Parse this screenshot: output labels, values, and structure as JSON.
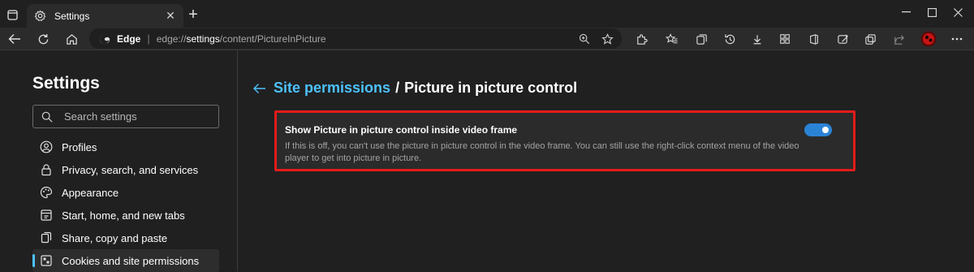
{
  "browser": {
    "tab_title": "Settings",
    "address_brand": "Edge",
    "url_prefix": "edge://",
    "url_bold": "settings",
    "url_suffix": "/content/PictureInPicture"
  },
  "sidebar": {
    "title": "Settings",
    "search_placeholder": "Search settings",
    "items": [
      {
        "label": "Profiles",
        "icon": "profile-icon"
      },
      {
        "label": "Privacy, search, and services",
        "icon": "lock-icon"
      },
      {
        "label": "Appearance",
        "icon": "palette-icon"
      },
      {
        "label": "Start, home, and new tabs",
        "icon": "start-icon"
      },
      {
        "label": "Share, copy and paste",
        "icon": "share-icon"
      },
      {
        "label": "Cookies and site permissions",
        "icon": "cookies-icon"
      }
    ]
  },
  "main": {
    "breadcrumb_link": "Site permissions",
    "breadcrumb_sep": "/",
    "breadcrumb_current": "Picture in picture control",
    "setting": {
      "title": "Show Picture in picture control inside video frame",
      "description": "If this is off, you can't use the picture in picture control in the video frame. You can still use the right-click context menu of the video player to get into picture in picture.",
      "enabled": true
    }
  },
  "colors": {
    "accent": "#4cc2ff",
    "toggle_on": "#2b83d6",
    "highlight_border": "#e31b1b"
  }
}
